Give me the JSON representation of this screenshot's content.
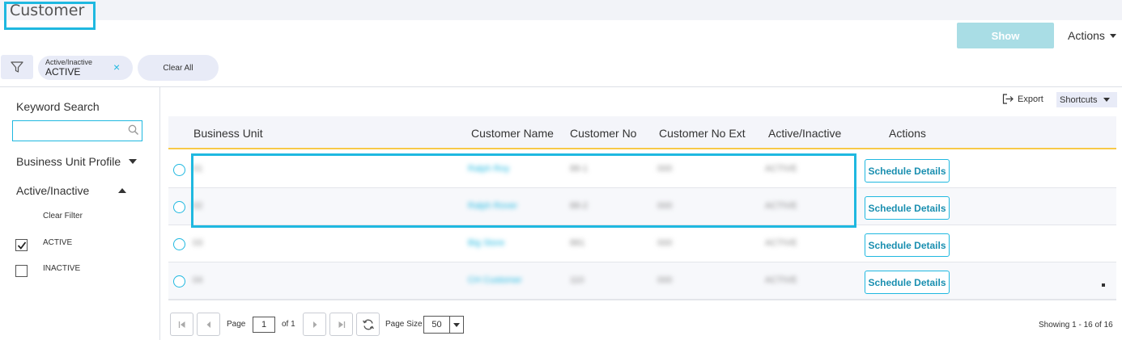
{
  "header": {
    "title": "Customer",
    "show_label": "Show",
    "actions_label": "Actions"
  },
  "filters": {
    "chip_label": "Active/Inactive",
    "chip_value": "ACTIVE",
    "chip_close": "×",
    "clear_all": "Clear All"
  },
  "sidebar": {
    "keyword_label": "Keyword Search",
    "keyword_value": "",
    "business_unit_profile": "Business Unit Profile",
    "active_inactive": "Active/Inactive",
    "clear_filter": "Clear Filter",
    "options": [
      {
        "label": "ACTIVE",
        "checked": true
      },
      {
        "label": "INACTIVE",
        "checked": false
      }
    ]
  },
  "toolbar": {
    "export_label": "Export",
    "shortcuts_label": "Shortcuts"
  },
  "grid": {
    "columns": [
      "Business Unit",
      "Customer Name",
      "Customer No",
      "Customer No Ext",
      "Active/Inactive",
      "Actions"
    ],
    "rows": [
      {
        "business_unit": "01",
        "customer_name": "Ralph Roy",
        "customer_no": "88-1",
        "customer_no_ext": "000",
        "status": "ACTIVE",
        "action": "Schedule Details"
      },
      {
        "business_unit": "02",
        "customer_name": "Ralph Rover",
        "customer_no": "88-2",
        "customer_no_ext": "000",
        "status": "ACTIVE",
        "action": "Schedule Details"
      },
      {
        "business_unit": "03",
        "customer_name": "Big Store",
        "customer_no": "881",
        "customer_no_ext": "000",
        "status": "ACTIVE",
        "action": "Schedule Details"
      },
      {
        "business_unit": "04",
        "customer_name": "CH Customer",
        "customer_no": "110",
        "customer_no_ext": "000",
        "status": "ACTIVE",
        "action": "Schedule Details"
      }
    ]
  },
  "pager": {
    "page_label": "Page",
    "current_page": "1",
    "of_label": "of 1",
    "page_size_label": "Page Size",
    "page_size": "50",
    "showing": "Showing 1 - 16 of 16"
  },
  "colors": {
    "accent": "#1fb8e0",
    "header_underline": "#f7c948",
    "chip_bg": "#e8ebf7"
  },
  "icons": {
    "filter": "funnel-icon",
    "search": "search-icon",
    "export": "export-icon",
    "refresh": "refresh-icon"
  }
}
